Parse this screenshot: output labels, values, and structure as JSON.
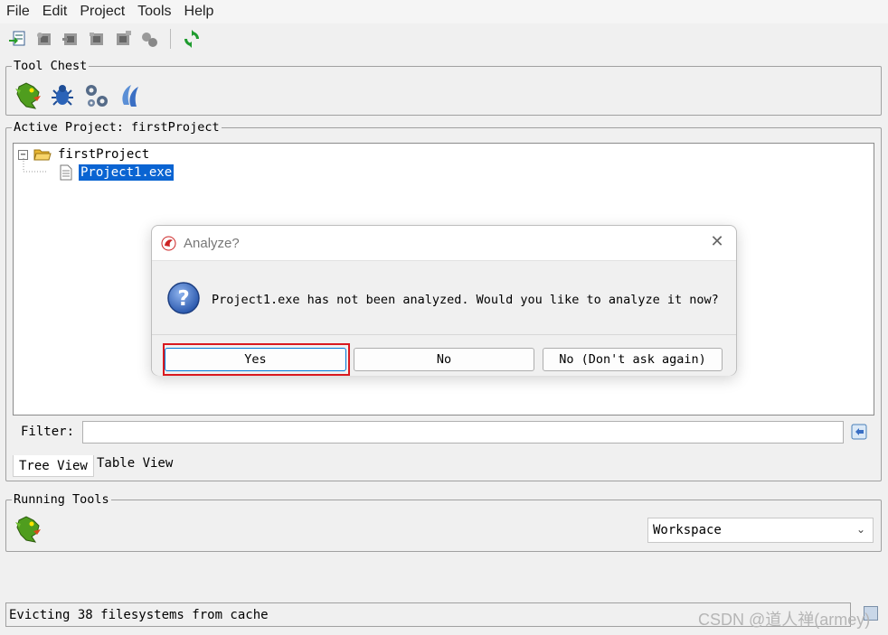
{
  "menubar": {
    "items": [
      "File",
      "Edit",
      "Project",
      "Tools",
      "Help"
    ]
  },
  "toolbar": {
    "icons": [
      "import-file-icon",
      "configure-icon",
      "batch-import-icon",
      "open-tool-icon",
      "close-tool-icon",
      "link-icon",
      "refresh-icon"
    ]
  },
  "tool_chest": {
    "title": "Tool Chest",
    "tools": [
      "dragon-codebrowser-icon",
      "debugger-icon",
      "gears-icon",
      "version-tracking-icon"
    ]
  },
  "active_project": {
    "title": "Active Project: firstProject",
    "tree": {
      "root": "firstProject",
      "child": "Project1.exe"
    },
    "filter_label": "Filter:",
    "filter_value": "",
    "tabs": [
      "Tree View",
      "Table View"
    ]
  },
  "running_tools": {
    "title": "Running Tools",
    "workspace_selected": "Workspace"
  },
  "status": {
    "message": "Evicting 38 filesystems from cache"
  },
  "watermark": "CSDN @道人禅(armey)",
  "dialog": {
    "title": "Analyze?",
    "message": "Project1.exe has not been analyzed. Would you like to analyze it now?",
    "buttons": {
      "yes": "Yes",
      "no": "No",
      "no_dont_ask": "No (Don't ask again)"
    }
  },
  "colors": {
    "selection": "#0a64d2",
    "highlight": "#d9191f",
    "question_icon": "#3a6fc4"
  }
}
